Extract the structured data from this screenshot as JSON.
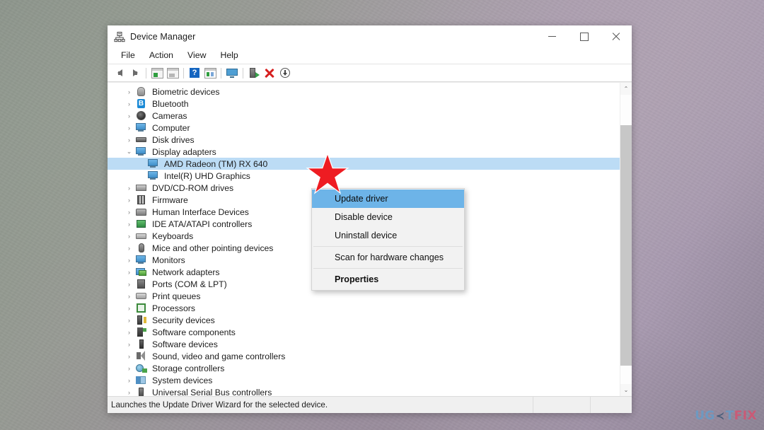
{
  "window": {
    "title": "Device Manager",
    "icon": "device-manager-icon",
    "controls": {
      "minimize": "Minimize",
      "maximize": "Maximize",
      "close": "Close"
    }
  },
  "menubar": {
    "items": [
      {
        "label": "File"
      },
      {
        "label": "Action"
      },
      {
        "label": "View"
      },
      {
        "label": "Help"
      }
    ]
  },
  "toolbar": {
    "buttons": [
      {
        "name": "back-arrow-icon"
      },
      {
        "name": "forward-arrow-icon"
      },
      {
        "name": "show-hide-console-tree-icon"
      },
      {
        "name": "properties-window-icon"
      },
      {
        "name": "help-icon",
        "glyph": "?"
      },
      {
        "name": "properties-icon"
      },
      {
        "name": "scan-for-hardware-changes-icon"
      },
      {
        "name": "update-driver-icon"
      },
      {
        "name": "uninstall-device-icon"
      },
      {
        "name": "disable-device-icon"
      }
    ]
  },
  "tree": {
    "nodes": [
      {
        "label": "Biometric devices",
        "level": 1,
        "expanded": false,
        "icon": "biometric-icon"
      },
      {
        "label": "Bluetooth",
        "level": 1,
        "expanded": false,
        "icon": "bluetooth-icon"
      },
      {
        "label": "Cameras",
        "level": 1,
        "expanded": false,
        "icon": "camera-icon"
      },
      {
        "label": "Computer",
        "level": 1,
        "expanded": false,
        "icon": "computer-icon"
      },
      {
        "label": "Disk drives",
        "level": 1,
        "expanded": false,
        "icon": "disk-drive-icon"
      },
      {
        "label": "Display adapters",
        "level": 1,
        "expanded": true,
        "icon": "display-adapter-icon"
      },
      {
        "label": "AMD Radeon (TM) RX 640",
        "level": 2,
        "selected": true,
        "icon": "display-adapter-icon"
      },
      {
        "label": "Intel(R) UHD Graphics",
        "level": 2,
        "selected": false,
        "icon": "display-adapter-icon"
      },
      {
        "label": "DVD/CD-ROM drives",
        "level": 1,
        "expanded": false,
        "icon": "dvd-drive-icon"
      },
      {
        "label": "Firmware",
        "level": 1,
        "expanded": false,
        "icon": "firmware-icon"
      },
      {
        "label": "Human Interface Devices",
        "level": 1,
        "expanded": false,
        "icon": "hid-icon"
      },
      {
        "label": "IDE ATA/ATAPI controllers",
        "level": 1,
        "expanded": false,
        "icon": "ide-controller-icon"
      },
      {
        "label": "Keyboards",
        "level": 1,
        "expanded": false,
        "icon": "keyboard-icon"
      },
      {
        "label": "Mice and other pointing devices",
        "level": 1,
        "expanded": false,
        "icon": "mouse-icon"
      },
      {
        "label": "Monitors",
        "level": 1,
        "expanded": false,
        "icon": "monitor-icon"
      },
      {
        "label": "Network adapters",
        "level": 1,
        "expanded": false,
        "icon": "network-adapter-icon"
      },
      {
        "label": "Ports (COM & LPT)",
        "level": 1,
        "expanded": false,
        "icon": "port-icon"
      },
      {
        "label": "Print queues",
        "level": 1,
        "expanded": false,
        "icon": "printer-icon"
      },
      {
        "label": "Processors",
        "level": 1,
        "expanded": false,
        "icon": "processor-icon"
      },
      {
        "label": "Security devices",
        "level": 1,
        "expanded": false,
        "icon": "security-device-icon"
      },
      {
        "label": "Software components",
        "level": 1,
        "expanded": false,
        "icon": "software-component-icon"
      },
      {
        "label": "Software devices",
        "level": 1,
        "expanded": false,
        "icon": "software-device-icon"
      },
      {
        "label": "Sound, video and game controllers",
        "level": 1,
        "expanded": false,
        "icon": "sound-controller-icon"
      },
      {
        "label": "Storage controllers",
        "level": 1,
        "expanded": false,
        "icon": "storage-controller-icon"
      },
      {
        "label": "System devices",
        "level": 1,
        "expanded": false,
        "icon": "system-device-icon"
      },
      {
        "label": "Universal Serial Bus controllers",
        "level": 1,
        "expanded": false,
        "icon": "usb-controller-icon"
      }
    ],
    "collapsed_chevron": "›",
    "expanded_chevron": "⌄"
  },
  "context_menu": {
    "items": [
      {
        "label": "Update driver",
        "highlighted": true,
        "bold": false,
        "separator_after": false
      },
      {
        "label": "Disable device",
        "highlighted": false,
        "bold": false,
        "separator_after": false
      },
      {
        "label": "Uninstall device",
        "highlighted": false,
        "bold": false,
        "separator_after": true
      },
      {
        "label": "Scan for hardware changes",
        "highlighted": false,
        "bold": false,
        "separator_after": true
      },
      {
        "label": "Properties",
        "highlighted": false,
        "bold": true,
        "separator_after": false
      }
    ],
    "highlight_color": "#6db4e8"
  },
  "scrollbar": {
    "up_arrow": "⌃",
    "down_arrow": "⌄"
  },
  "statusbar": {
    "message": "Launches the Update Driver Wizard for the selected device."
  },
  "annotation": {
    "star": {
      "name": "red-star-marker",
      "color": "#ee1c22"
    }
  },
  "watermark": {
    "part1": "UG",
    "part2": "T",
    "part3": "FIX",
    "colors": {
      "blue": "#5f9fcf",
      "red": "#e04a6a"
    }
  }
}
